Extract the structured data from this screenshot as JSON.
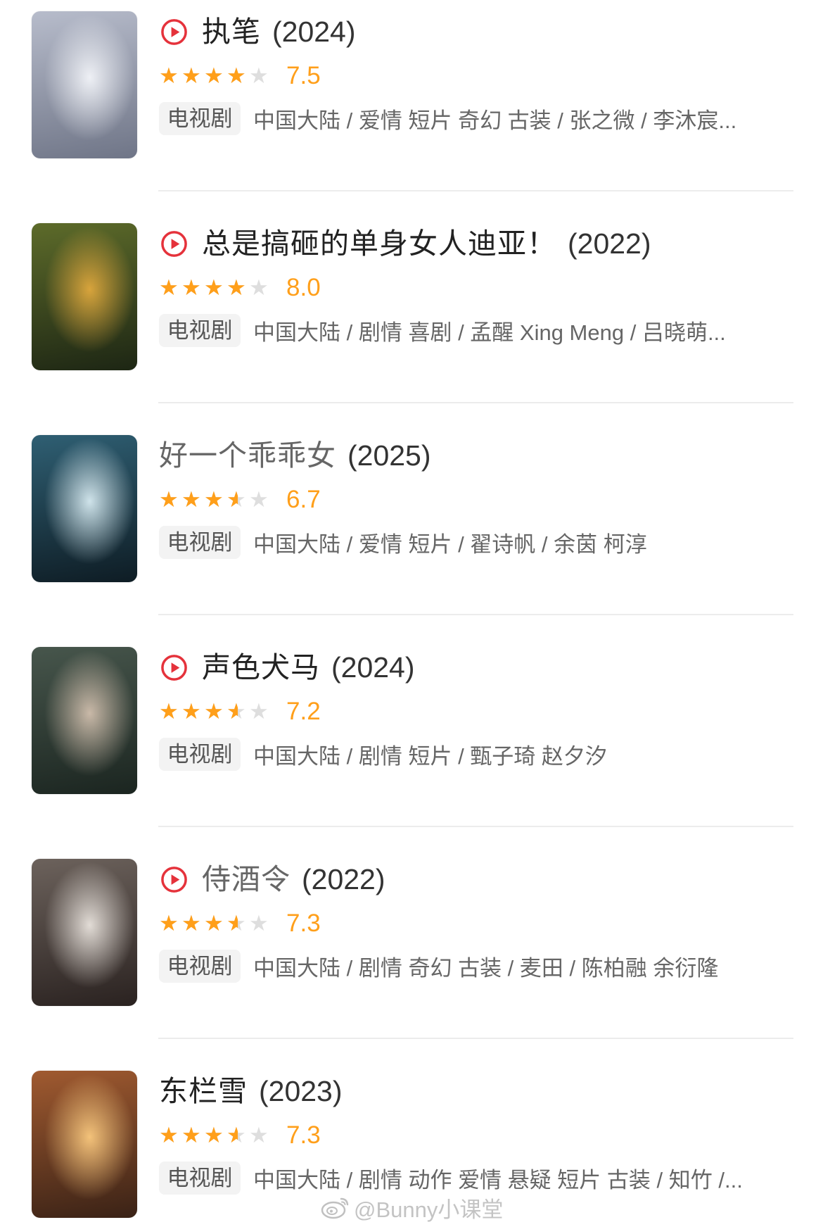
{
  "list": {
    "items": [
      {
        "name": "执笔",
        "year": "(2024)",
        "icon": "play-circle-icon",
        "name_color": "#222222",
        "stars": 4,
        "rating": "7.5",
        "type_badge": "电视剧",
        "info": "中国大陆 / 爱情 短片 奇幻 古装 / 张之微 / 李沐宸...",
        "poster_colors": [
          "#eef0f5",
          "#b7bccb",
          "#6f7587"
        ]
      },
      {
        "name": "总是搞砸的单身女人迪亚！",
        "year": "(2022)",
        "icon": "play-circle-icon",
        "name_color": "#222222",
        "stars": 4,
        "rating": "8.0",
        "type_badge": "电视剧",
        "info": "中国大陆 / 剧情 喜剧 / 孟醒 Xing Meng / 吕晓萌...",
        "poster_colors": [
          "#d8a43c",
          "#5d6b2a",
          "#1d2614"
        ]
      },
      {
        "name": "好一个乖乖女",
        "year": "(2025)",
        "icon": "",
        "name_color": "#666666",
        "stars": 3.5,
        "rating": "6.7",
        "type_badge": "电视剧",
        "info": "中国大陆 / 爱情 短片 / 翟诗帆 / 余茵 柯淳",
        "poster_colors": [
          "#cfe3ea",
          "#2f5f73",
          "#0e1c24"
        ]
      },
      {
        "name": "声色犬马",
        "year": "(2024)",
        "icon": "play-circle-icon",
        "name_color": "#222222",
        "stars": 3.5,
        "rating": "7.2",
        "type_badge": "电视剧",
        "info": "中国大陆 / 剧情 短片 / 甄子琦 赵夕汐",
        "poster_colors": [
          "#c9b9a8",
          "#47564c",
          "#1b2520"
        ]
      },
      {
        "name": "侍酒令",
        "year": "(2022)",
        "icon": "play-circle-icon",
        "name_color": "#666666",
        "stars": 3.5,
        "rating": "7.3",
        "type_badge": "电视剧",
        "info": "中国大陆 / 剧情 奇幻 古装 / 麦田 / 陈柏融 余衍隆",
        "poster_colors": [
          "#e2dcd6",
          "#6c625c",
          "#2a2220"
        ]
      },
      {
        "name": "东栏雪",
        "year": "(2023)",
        "icon": "",
        "name_color": "#222222",
        "stars": 3.5,
        "rating": "7.3",
        "type_badge": "电视剧",
        "info": "中国大陆 / 剧情 动作 爱情 悬疑 短片 古装 / 知竹 /...",
        "poster_colors": [
          "#f3c27a",
          "#a05a30",
          "#3a2216"
        ]
      }
    ]
  },
  "watermark": {
    "icon": "weibo-icon",
    "text": "@Bunny小课堂"
  },
  "colors": {
    "star_active": "#ff9f1a",
    "star_inactive": "#dedede",
    "play_icon": "#e5323b",
    "divider": "#ececec",
    "badge_bg": "#f3f3f3"
  }
}
